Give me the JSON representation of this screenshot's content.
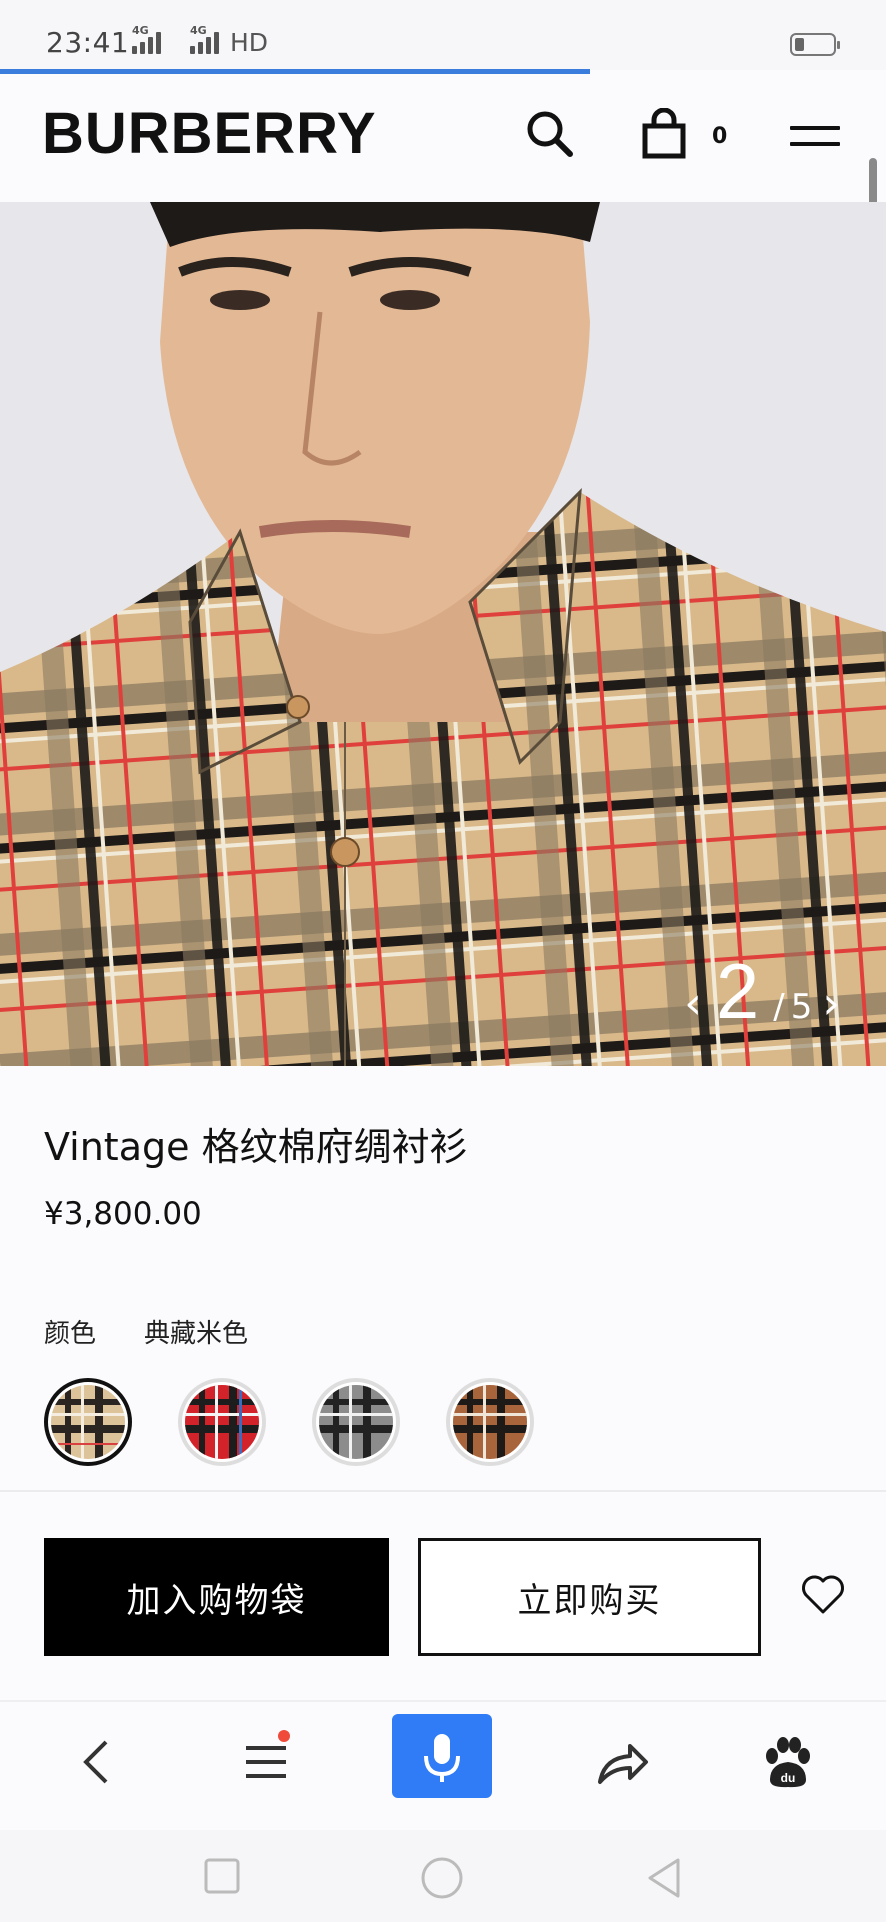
{
  "status_bar": {
    "time": "23:41",
    "network_1": "4G",
    "network_2": "4G",
    "hd": "HD"
  },
  "header": {
    "logo": "BURBERRY",
    "bag_count": "0",
    "icons": [
      "search-icon",
      "shopping-bag-icon",
      "hamburger-menu-icon"
    ]
  },
  "carousel": {
    "current": "2",
    "separator": "/",
    "total": "5",
    "prev_arrow": "‹",
    "next_arrow": "›"
  },
  "product": {
    "name": "Vintage 格纹棉府绸衬衫",
    "price": "¥3,800.00",
    "color_label": "颜色",
    "color_value": "典藏米色",
    "swatches": [
      {
        "name": "典藏米色",
        "base": "#dcc39a",
        "selected": true
      },
      {
        "name": "red",
        "base": "#d2222a",
        "selected": false
      },
      {
        "name": "grey",
        "base": "#8c8c8c",
        "selected": false
      },
      {
        "name": "brown",
        "base": "#a8643a",
        "selected": false
      }
    ]
  },
  "actions": {
    "add_to_bag": "加入购物袋",
    "buy_now": "立即购买"
  },
  "browser_toolbar": {
    "icons": [
      "back-icon",
      "menu-icon",
      "microphone-icon",
      "share-icon",
      "baidu-paw-icon"
    ]
  },
  "colors": {
    "accent_blue": "#2f7cf6",
    "button_black": "#000000",
    "notification_red": "#f04a3a"
  }
}
